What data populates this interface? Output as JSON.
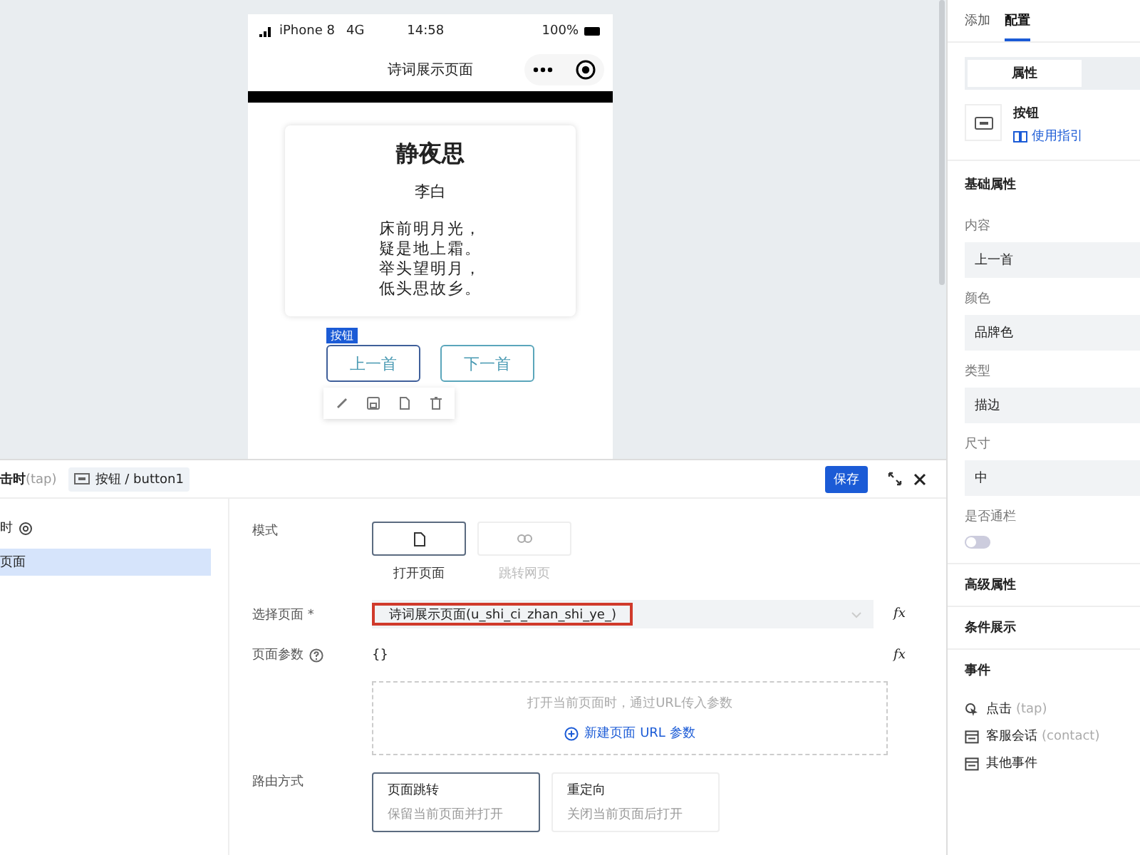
{
  "phone": {
    "status": {
      "carrier": "iPhone 8",
      "network": "4G",
      "time": "14:58",
      "battery": "100%"
    },
    "nav_title": "诗词展示页面",
    "poem": {
      "title": "静夜思",
      "author": "李白",
      "lines": [
        "床前明月光，",
        "疑是地上霜。",
        "举头望明月，",
        "低头思故乡。"
      ]
    },
    "selected_tag": "按钮",
    "buttons": [
      {
        "label": "上一首",
        "selected": true
      },
      {
        "label": "下一首",
        "selected": false
      }
    ]
  },
  "event_panel": {
    "trigger": "击时",
    "trigger_hint": "(tap)",
    "component": "按钮 / button1",
    "save": "保存",
    "sidebar": {
      "group": "时",
      "items": [
        {
          "label": "页面",
          "selected": true
        }
      ]
    },
    "mode": {
      "label": "模式",
      "options": [
        {
          "label": "打开页面",
          "kind": "page",
          "selected": true
        },
        {
          "label": "跳转网页",
          "kind": "link",
          "selected": false
        }
      ]
    },
    "select_page": {
      "label": "选择页面 *",
      "value": "诗词展示页面(u_shi_ci_zhan_shi_ye_)",
      "formula": "fx"
    },
    "params": {
      "label": "页面参数",
      "value": "{}",
      "formula": "fx",
      "hint": "打开当前页面时，通过URL传入参数",
      "add": "新建页面 URL 参数"
    },
    "route": {
      "label": "路由方式",
      "options": [
        {
          "title": "页面跳转",
          "desc": "保留当前页面并打开",
          "selected": true
        },
        {
          "title": "重定向",
          "desc": "关闭当前页面后打开",
          "selected": false
        }
      ]
    }
  },
  "right_panel": {
    "tabs": [
      {
        "label": "添加",
        "selected": false
      },
      {
        "label": "配置",
        "selected": true
      }
    ],
    "segments": [
      {
        "label": "属性",
        "selected": true
      }
    ],
    "component": {
      "name": "按钮",
      "guide": "使用指引"
    },
    "section": "基础属性",
    "fields": [
      {
        "label": "内容",
        "value": "上一首"
      },
      {
        "label": "颜色",
        "value": "品牌色"
      },
      {
        "label": "类型",
        "value": "描边"
      },
      {
        "label": "尺寸",
        "value": "中"
      }
    ],
    "toggle": {
      "label": "是否通栏",
      "on": false
    },
    "sections": [
      "高级属性",
      "条件展示"
    ],
    "events": {
      "title": "事件",
      "items": [
        {
          "label": "点击",
          "hint": "(tap)",
          "kind": "tap"
        },
        {
          "label": "客服会话",
          "hint": "(contact)",
          "kind": "calendar"
        },
        {
          "label": "其他事件",
          "kind": "calendar"
        }
      ]
    }
  }
}
